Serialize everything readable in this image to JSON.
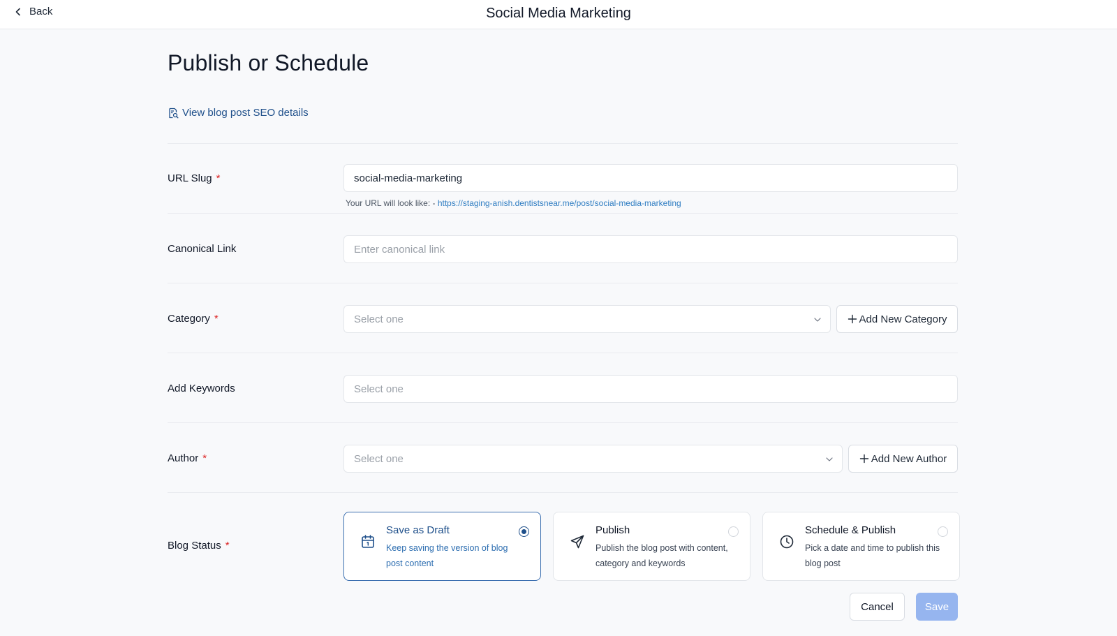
{
  "header": {
    "back_label": "Back",
    "title": "Social Media Marketing"
  },
  "page": {
    "title": "Publish or Schedule",
    "seo_link": "View blog post SEO details"
  },
  "form": {
    "url_slug": {
      "label": "URL Slug",
      "required": "*",
      "value": "social-media-marketing",
      "hint_prefix": "Your URL will look like: -",
      "hint_url": "https://staging-anish.dentistsnear.me/post/social-media-marketing"
    },
    "canonical": {
      "label": "Canonical Link",
      "placeholder": "Enter canonical link"
    },
    "category": {
      "label": "Category",
      "required": "*",
      "placeholder": "Select one",
      "add_label": "Add New Category"
    },
    "keywords": {
      "label": "Add Keywords",
      "placeholder": "Select one"
    },
    "author": {
      "label": "Author",
      "required": "*",
      "placeholder": "Select one",
      "add_label": "Add New Author"
    },
    "blog_status": {
      "label": "Blog Status",
      "required": "*",
      "options": [
        {
          "title": "Save as Draft",
          "desc": "Keep saving the version of blog post content",
          "icon": "calendar-icon",
          "selected": true
        },
        {
          "title": "Publish",
          "desc": "Publish the blog post with content, category and keywords",
          "icon": "send-icon",
          "selected": false
        },
        {
          "title": "Schedule & Publish",
          "desc": "Pick a date and time to publish this blog post",
          "icon": "clock-icon",
          "selected": false
        }
      ]
    }
  },
  "actions": {
    "cancel": "Cancel",
    "save": "Save"
  },
  "colors": {
    "accent": "#1e4f8a",
    "link": "#2f7dc2",
    "required": "#dc2626",
    "save_disabled": "#96b5ef",
    "background": "#f8f9fb"
  }
}
